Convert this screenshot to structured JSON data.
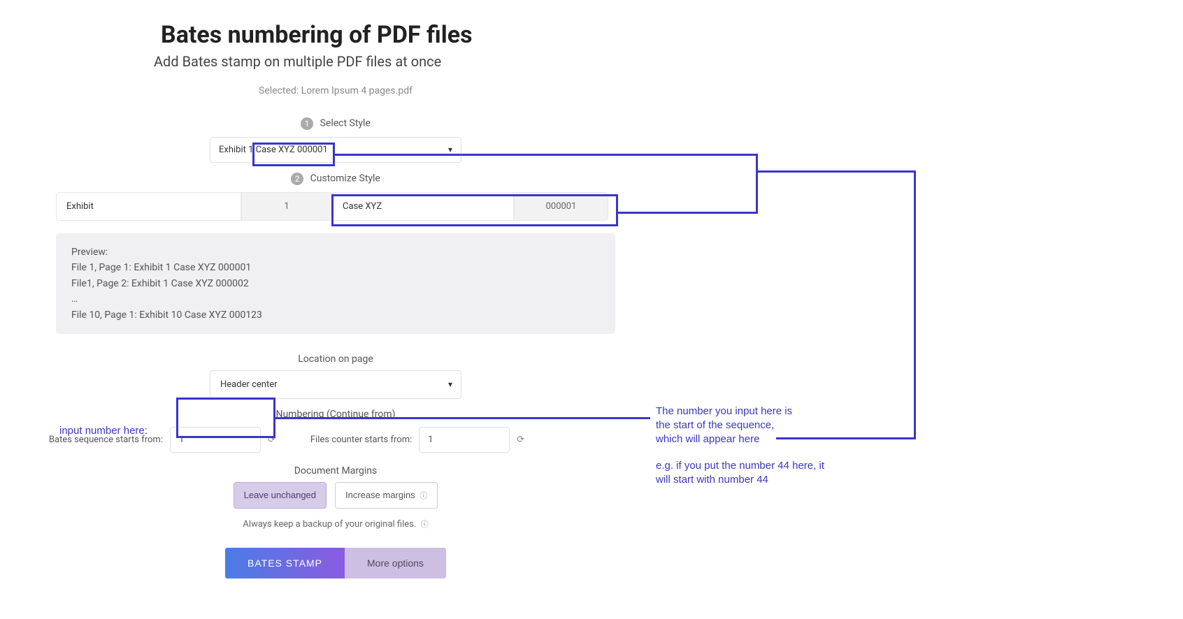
{
  "header": {
    "title": "Bates numbering of PDF files",
    "subtitle": "Add Bates stamp on multiple PDF files at once",
    "selected_prefix": "Selected: ",
    "selected_file": "Lorem Ipsum 4 pages.pdf"
  },
  "step1": {
    "num": "1",
    "label": "Select Style",
    "value": "Exhibit 1 Case XYZ 000001"
  },
  "step2": {
    "num": "2",
    "label": "Customize Style",
    "prefix": "Exhibit",
    "file_num": "1",
    "case": "Case XYZ",
    "sequence": "000001"
  },
  "preview": {
    "label": "Preview:",
    "line1": "File 1, Page 1: Exhibit 1 Case XYZ 000001",
    "line2": "File1, Page 2: Exhibit 1 Case XYZ 000002",
    "ellipsis": "…",
    "line3": "File 10, Page 1: Exhibit 10 Case XYZ 000123"
  },
  "location": {
    "label": "Location on page",
    "value": "Header center"
  },
  "numbering": {
    "label": "Numbering (Continue from)",
    "bates_label": "Bates sequence starts from:",
    "bates_value": "1",
    "files_label": "Files counter starts from:",
    "files_value": "1"
  },
  "margins": {
    "label": "Document Margins",
    "unchanged": "Leave unchanged",
    "increase": "Increase margins"
  },
  "backup": "Always keep a backup of your original files.",
  "actions": {
    "primary": "BATES STAMP",
    "secondary": "More options"
  },
  "annotations": {
    "input_label": "input number here:",
    "explain1": "The number you input here is",
    "explain2": "the start of the sequence,",
    "explain3": "which will appear here",
    "eg1": "e.g. if you put the number 44 here, it",
    "eg2": "will start with number 44"
  },
  "help_glyph": "ⓘ"
}
